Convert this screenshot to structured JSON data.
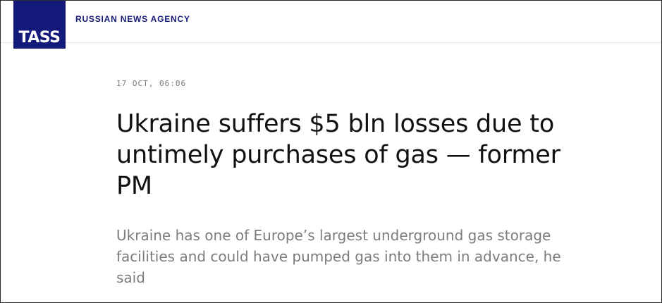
{
  "header": {
    "logo_text": "TASS",
    "agency_name": "RUSSIAN NEWS AGENCY"
  },
  "article": {
    "dateline": "17 OCT, 06:06",
    "headline": "Ukraine suffers $5 bln losses due to untimely purchases of gas — former PM",
    "lead": "Ukraine has one of Europe’s largest underground gas storage facilities and could have pumped gas into them in advance, he said"
  },
  "colors": {
    "brand": "#141a7a",
    "headline": "#111111",
    "lead": "#7c7c7c",
    "dateline": "#7a7a7a"
  }
}
